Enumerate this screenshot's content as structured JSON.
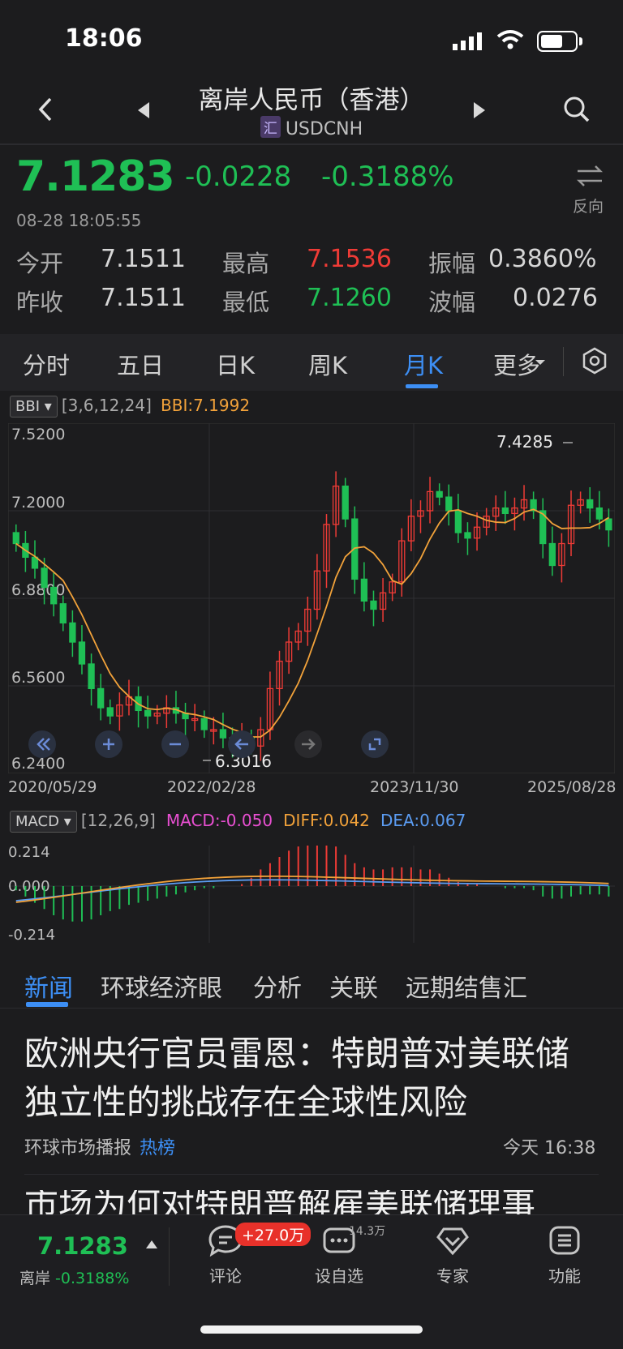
{
  "status_bar": {
    "time": "18:06"
  },
  "header": {
    "title": "离岸人民币（香港）",
    "tag": "汇",
    "symbol": "USDCNH"
  },
  "quote": {
    "price": "7.1283",
    "change": "-0.0228",
    "change_pct": "-0.3188%",
    "timestamp": "08-28 18:05:55",
    "reverse_label": "反向",
    "rows": [
      {
        "l1": "今开",
        "v1": "7.1511",
        "l2": "最高",
        "v2": "7.1536",
        "l3": "振幅",
        "v3": "0.3860%"
      },
      {
        "l1": "昨收",
        "v1": "7.1511",
        "l2": "最低",
        "v2": "7.1260",
        "l3": "波幅",
        "v3": "0.0276"
      }
    ],
    "colors": {
      "down": "#1fbf55",
      "up": "#ef3b36"
    }
  },
  "period_tabs": [
    "分时",
    "五日",
    "日K",
    "周K",
    "月K",
    "更多"
  ],
  "active_period": "月K",
  "indicator": {
    "name": "BBI",
    "params": "[3,6,12,24]",
    "value_label": "BBI:7.1992"
  },
  "macd": {
    "name": "MACD",
    "params": "[12,26,9]",
    "macd_label": "MACD:-0.050",
    "diff_label": "DIFF:0.042",
    "dea_label": "DEA:0.067",
    "y_ticks": [
      "0.214",
      "0.000",
      "-0.214"
    ]
  },
  "chart_data": {
    "type": "candlestick",
    "y_ticks": [
      "7.5200",
      "7.2000",
      "6.8800",
      "6.5600",
      "6.2400"
    ],
    "x_ticks": [
      "2020/05/29",
      "2022/02/28",
      "2023/11/30",
      "2025/08/28"
    ],
    "max_label": "7.4285",
    "min_label": "6.3016",
    "ylim": [
      6.24,
      7.52
    ]
  },
  "news_tabs": [
    "新闻",
    "环球经济眼",
    "分析",
    "关联",
    "远期结售汇"
  ],
  "news": [
    {
      "headline": "欧洲央行官员雷恩：特朗普对美联储独立性的挑战存在全球性风险",
      "source": "环球市场播报",
      "tag": "热榜",
      "time": "今天 16:38"
    },
    {
      "headline": "市场为何对特朗普解雇美联储理事"
    }
  ],
  "bottom_bar": {
    "price": "7.1283",
    "label": "离岸",
    "change_pct": "-0.3188%",
    "items": [
      {
        "label": "评论",
        "badge": "+27.0万"
      },
      {
        "label": "设自选",
        "count": "14.3万"
      },
      {
        "label": "专家"
      },
      {
        "label": "功能"
      }
    ]
  }
}
